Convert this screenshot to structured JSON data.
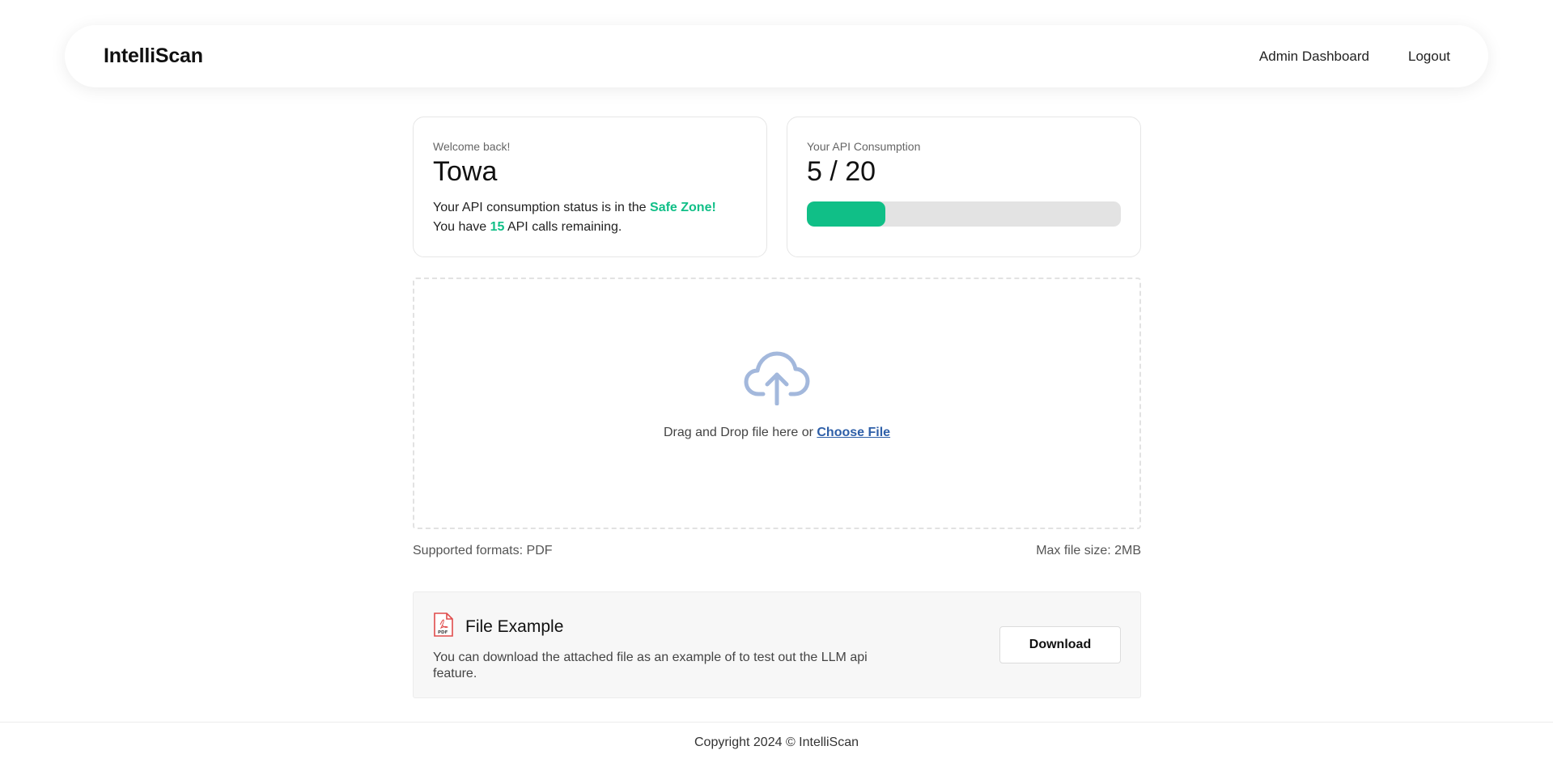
{
  "nav": {
    "brand": "IntelliScan",
    "links": [
      "Admin Dashboard",
      "Logout"
    ]
  },
  "welcome": {
    "label": "Welcome back!",
    "username": "Towa",
    "status_prefix": "Your API consumption status is in the",
    "status_zone": "Safe Zone!",
    "remaining_prefix": "You have",
    "remaining_count": "15",
    "remaining_suffix": "API calls remaining."
  },
  "consumption": {
    "label": "Your API Consumption",
    "value_text": "5 / 20",
    "used": 5,
    "limit": 20
  },
  "upload": {
    "icon": "cloud-upload-icon",
    "prompt": "Drag and Drop file here or",
    "choose_label": "Choose File",
    "supported_formats": "Supported formats: PDF",
    "max_size": "Max file size: 2MB"
  },
  "example": {
    "icon": "pdf-file-icon",
    "title": "File Example",
    "description": "You can download the attached file as an example of to test out the LLM api feature.",
    "download_label": "Download"
  },
  "footer": {
    "text": "Copyright 2024 © IntelliScan"
  },
  "colors": {
    "accent": "#10bf87",
    "link": "#2e5fa8",
    "icon": "#a3b8dc",
    "pdf": "#e04b4b"
  }
}
